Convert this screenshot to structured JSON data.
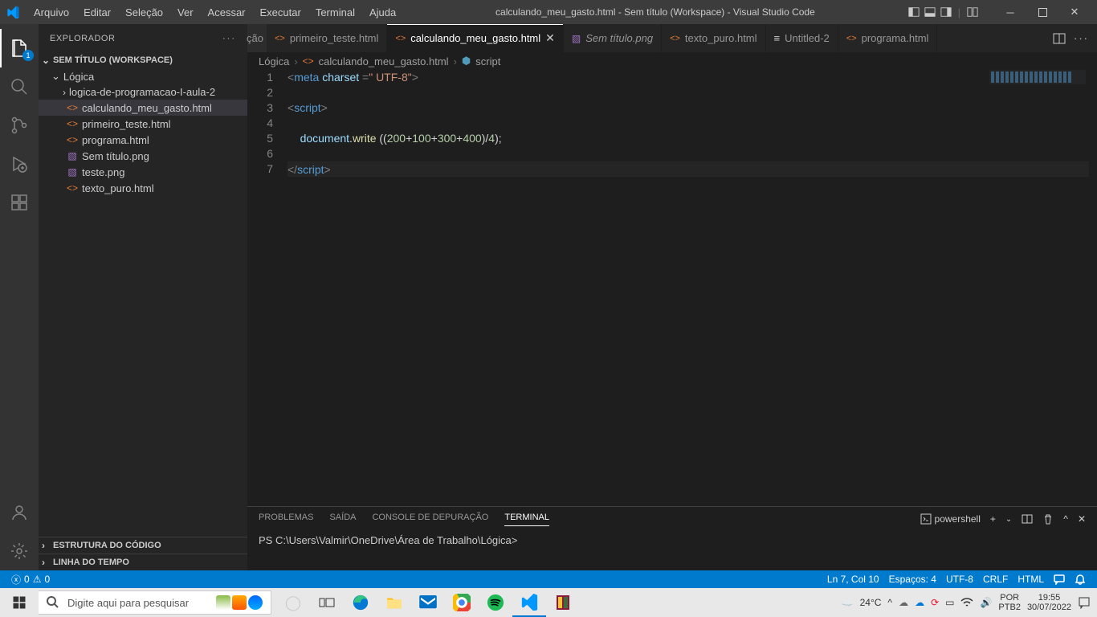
{
  "window": {
    "title": "calculando_meu_gasto.html - Sem título (Workspace) - Visual Studio Code"
  },
  "menu": {
    "items": [
      "Arquivo",
      "Editar",
      "Seleção",
      "Ver",
      "Acessar",
      "Executar",
      "Terminal",
      "Ajuda"
    ]
  },
  "activitybar": {
    "explorer_badge": "1"
  },
  "sidebar": {
    "title": "EXPLORADOR",
    "workspace": "SEM TÍTULO (WORKSPACE)",
    "root_folder": "Lógica",
    "subfolder": "logica-de-programacao-I-aula-2",
    "files": [
      {
        "name": "calculando_meu_gasto.html",
        "type": "html",
        "active": true
      },
      {
        "name": "primeiro_teste.html",
        "type": "html"
      },
      {
        "name": "programa.html",
        "type": "html"
      },
      {
        "name": "Sem título.png",
        "type": "img"
      },
      {
        "name": "teste.png",
        "type": "img"
      },
      {
        "name": "texto_puro.html",
        "type": "html"
      }
    ],
    "bottom": [
      "ESTRUTURA DO CÓDIGO",
      "LINHA DO TEMPO"
    ]
  },
  "tabs": {
    "partial": "ção",
    "list": [
      {
        "label": "primeiro_teste.html",
        "icon": "html"
      },
      {
        "label": "calculando_meu_gasto.html",
        "icon": "html",
        "active": true,
        "closable": true
      },
      {
        "label": "Sem título.png",
        "icon": "img",
        "italic": true
      },
      {
        "label": "texto_puro.html",
        "icon": "html"
      },
      {
        "label": "Untitled-2",
        "icon": "file"
      },
      {
        "label": "programa.html",
        "icon": "html"
      }
    ]
  },
  "breadcrumbs": {
    "parts": [
      "Lógica",
      "calculando_meu_gasto.html",
      "script"
    ]
  },
  "code": {
    "lines": [
      {
        "n": "1",
        "html": "<span class='c-tag'>&lt;</span><span class='c-name'>meta</span> <span class='c-attr'>charset</span> <span class='c-tag'>=</span><span class='c-str'>\" UTF-8\"</span><span class='c-tag'>&gt;</span>"
      },
      {
        "n": "2",
        "html": ""
      },
      {
        "n": "3",
        "html": "<span class='c-tag'>&lt;</span><span class='c-name'>script</span><span class='c-tag'>&gt;</span>"
      },
      {
        "n": "4",
        "html": ""
      },
      {
        "n": "5",
        "html": "    <span class='c-obj'>document</span><span class='c-punc'>.</span><span class='c-fn'>write</span> <span class='c-punc'>((</span><span class='c-num'>200</span><span class='c-op'>+</span><span class='c-num'>100</span><span class='c-op'>+</span><span class='c-num'>300</span><span class='c-op'>+</span><span class='c-num'>400</span><span class='c-punc'>)</span><span class='c-op'>/</span><span class='c-num'>4</span><span class='c-punc'>);</span>"
      },
      {
        "n": "6",
        "html": ""
      },
      {
        "n": "7",
        "html": "<span class='c-tag'>&lt;/</span><span class='c-name'>script</span><span class='c-tag'>&gt;</span>",
        "cursor": true
      }
    ]
  },
  "panel": {
    "tabs": [
      "PROBLEMAS",
      "SAÍDA",
      "CONSOLE DE DEPURAÇÃO",
      "TERMINAL"
    ],
    "active_tab": "TERMINAL",
    "shell_label": "powershell",
    "terminal_prompt": "PS C:\\Users\\Valmir\\OneDrive\\Área de Trabalho\\Lógica>"
  },
  "statusbar": {
    "errors": "0",
    "warnings": "0",
    "position": "Ln 7, Col 10",
    "spaces": "Espaços: 4",
    "encoding": "UTF-8",
    "eol": "CRLF",
    "lang": "HTML"
  },
  "taskbar": {
    "search_placeholder": "Digite aqui para pesquisar",
    "weather": "24°C",
    "lang": "POR",
    "kb": "PTB2",
    "time": "19:55",
    "date": "30/07/2022"
  }
}
